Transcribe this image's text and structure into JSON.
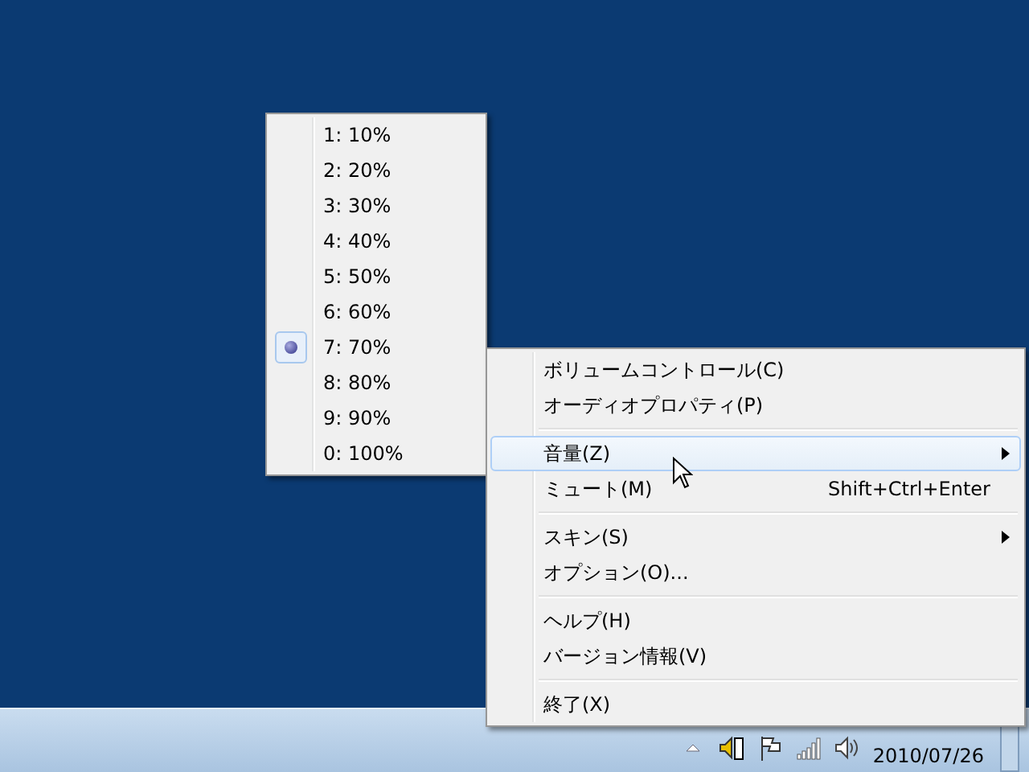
{
  "volume_submenu": {
    "items": [
      {
        "label": "1: 10%",
        "selected": false
      },
      {
        "label": "2: 20%",
        "selected": false
      },
      {
        "label": "3: 30%",
        "selected": false
      },
      {
        "label": "4: 40%",
        "selected": false
      },
      {
        "label": "5: 50%",
        "selected": false
      },
      {
        "label": "6: 60%",
        "selected": false
      },
      {
        "label": "7: 70%",
        "selected": true
      },
      {
        "label": "8: 80%",
        "selected": false
      },
      {
        "label": "9: 90%",
        "selected": false
      },
      {
        "label": "0: 100%",
        "selected": false
      }
    ]
  },
  "context_menu": {
    "items": [
      {
        "kind": "item",
        "label": "ボリュームコントロール(C)",
        "selected": false
      },
      {
        "kind": "item",
        "label": "オーディオプロパティ(P)",
        "selected": false
      },
      {
        "kind": "separator"
      },
      {
        "kind": "item",
        "label": "音量(Z)",
        "selected": true,
        "submenu": true
      },
      {
        "kind": "item",
        "label": "ミュート(M)",
        "selected": false,
        "shortcut": "Shift+Ctrl+Enter"
      },
      {
        "kind": "separator"
      },
      {
        "kind": "item",
        "label": "スキン(S)",
        "selected": false,
        "submenu": true
      },
      {
        "kind": "item",
        "label": "オプション(O)...",
        "selected": false
      },
      {
        "kind": "separator"
      },
      {
        "kind": "item",
        "label": "ヘルプ(H)",
        "selected": false
      },
      {
        "kind": "item",
        "label": "バージョン情報(V)",
        "selected": false
      },
      {
        "kind": "separator"
      },
      {
        "kind": "item",
        "label": "終了(X)",
        "selected": false
      }
    ]
  },
  "taskbar": {
    "date": "2010/07/26"
  }
}
